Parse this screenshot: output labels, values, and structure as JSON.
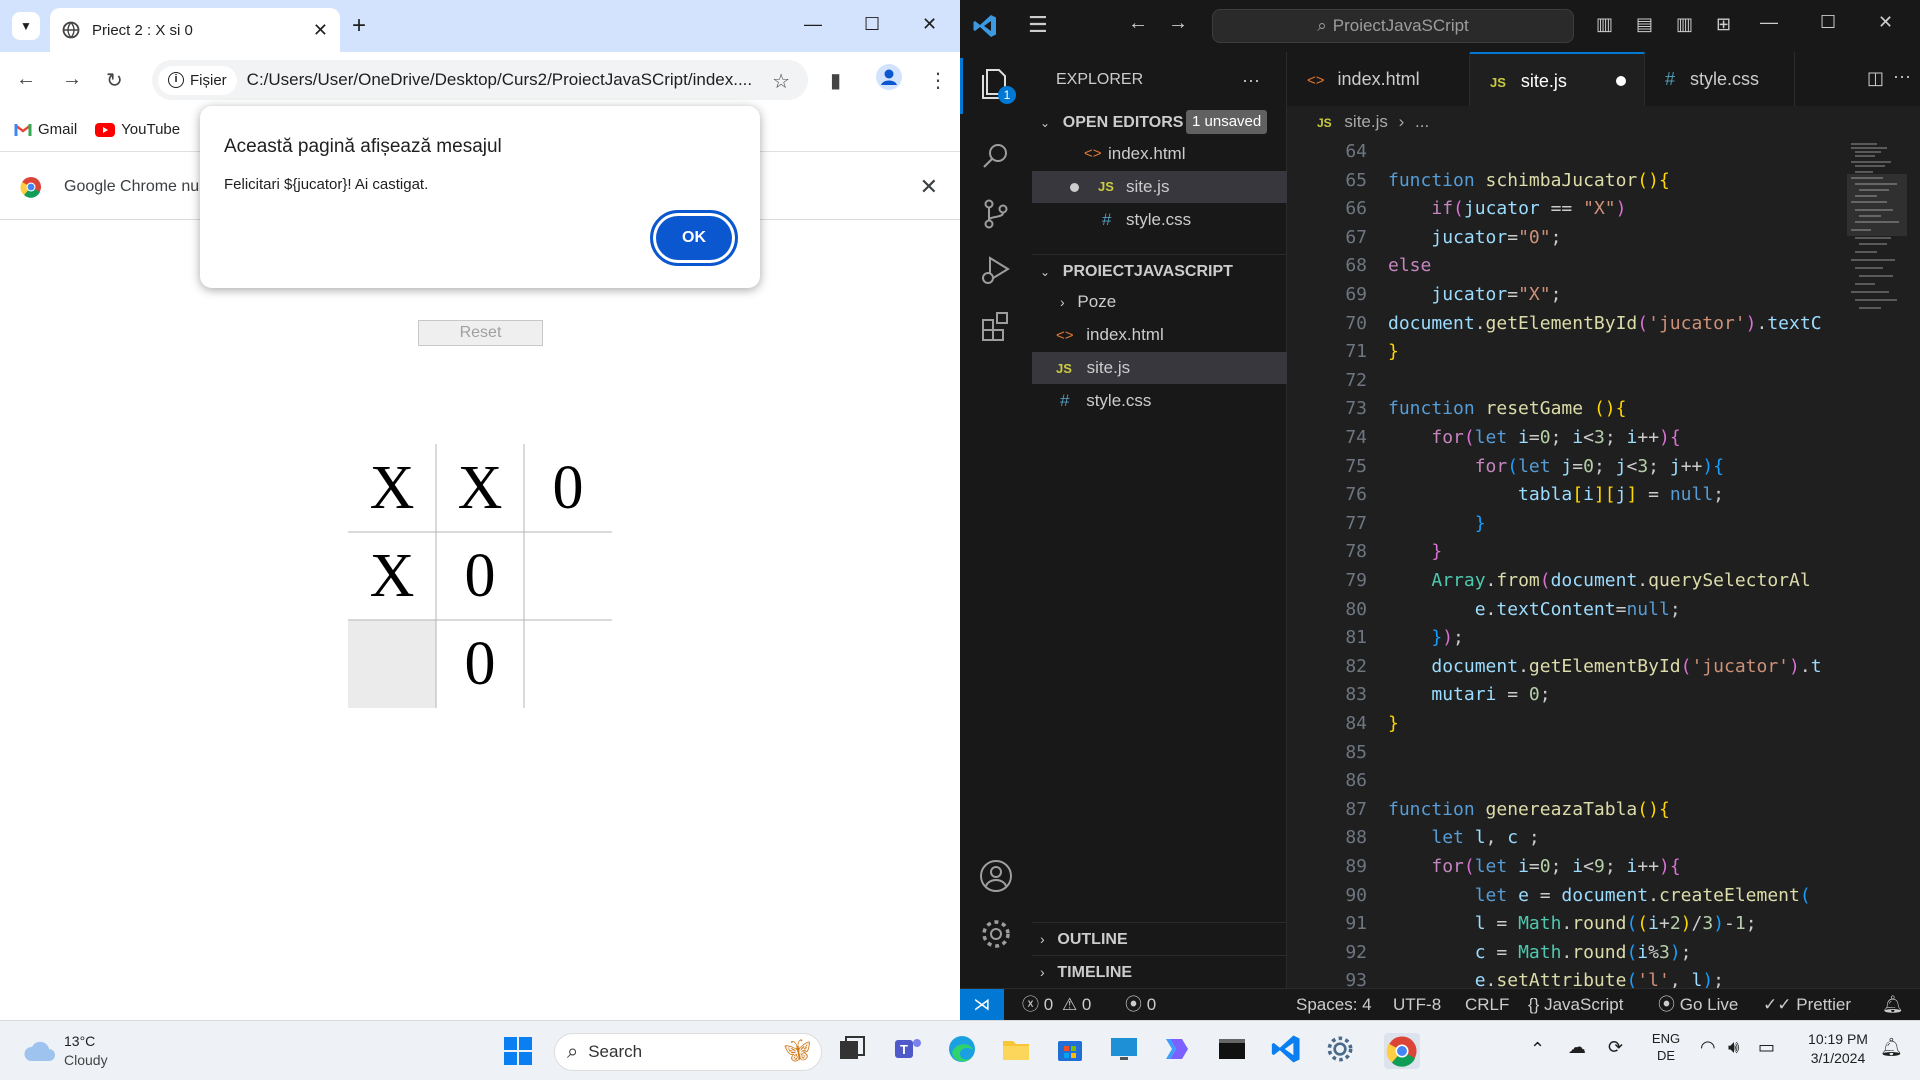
{
  "chrome": {
    "tab_title": "Priect 2 : X si 0",
    "address_chip": "Fișier",
    "url": "C:/Users/User/OneDrive/Desktop/Curs2/ProiectJavaSCript/index....",
    "bookmarks": [
      "Gmail",
      "YouTube"
    ],
    "infobar_text": "Google Chrome nu",
    "alert": {
      "title": "Această pagină afișează mesajul",
      "message": "Felicitari ${jucator}! Ai castigat.",
      "ok_label": "OK"
    },
    "reset_label": "Reset",
    "board": [
      [
        "X",
        "X",
        "0"
      ],
      [
        "X",
        "0",
        ""
      ],
      [
        "",
        "0",
        ""
      ]
    ]
  },
  "vscode": {
    "command_center": "ProiectJavaSCript",
    "explorer_title": "EXPLORER",
    "open_editors_label": "OPEN EDITORS",
    "unsaved_badge": "1 unsaved",
    "open_editors": [
      "index.html",
      "site.js",
      "style.css"
    ],
    "project_label": "PROIECTJAVASCRIPT",
    "project_items": [
      "Poze",
      "index.html",
      "site.js",
      "style.css"
    ],
    "outline_label": "OUTLINE",
    "timeline_label": "TIMELINE",
    "tabs": [
      "index.html",
      "site.js",
      "style.css"
    ],
    "breadcrumb": "site.js",
    "breadcrumb_more": "...",
    "activity_badge": "1",
    "code_lines": [
      {
        "n": "64",
        "html": ""
      },
      {
        "n": "65",
        "html": "<span class='b'>function</span> <span class='f'>schimbaJucator</span><span class='y'>()</span><span class='y'>{</span>"
      },
      {
        "n": "66",
        "html": "    <span class='k'>if</span><span class='p'>(</span><span class='v'>jucator</span> == <span class='s'>\"X\"</span><span class='p'>)</span>"
      },
      {
        "n": "67",
        "html": "    <span class='v'>jucator</span>=<span class='s'>\"0\"</span>;"
      },
      {
        "n": "68",
        "html": "<span class='k'>else</span>"
      },
      {
        "n": "69",
        "html": "    <span class='v'>jucator</span>=<span class='s'>\"X\"</span>;"
      },
      {
        "n": "70",
        "html": "<span class='v'>document</span>.<span class='f'>getElementById</span><span class='p'>(</span><span class='s'>'jucator'</span><span class='p'>)</span>.<span class='v'>textC</span>"
      },
      {
        "n": "71",
        "html": "<span class='y'>}</span>"
      },
      {
        "n": "72",
        "html": ""
      },
      {
        "n": "73",
        "html": "<span class='b'>function</span> <span class='f'>resetGame</span> <span class='y'>()</span><span class='y'>{</span>"
      },
      {
        "n": "74",
        "html": "    <span class='k'>for</span><span class='p'>(</span><span class='b'>let</span> <span class='v'>i</span>=<span class='n'>0</span>; <span class='v'>i</span>&lt;<span class='n'>3</span>; <span class='v'>i</span>++<span class='p'>)</span><span class='p'>{</span>"
      },
      {
        "n": "75",
        "html": "        <span class='k'>for</span><span class='bl'>(</span><span class='b'>let</span> <span class='v'>j</span>=<span class='n'>0</span>; <span class='v'>j</span>&lt;<span class='n'>3</span>; <span class='v'>j</span>++<span class='bl'>)</span><span class='bl'>{</span>"
      },
      {
        "n": "76",
        "html": "            <span class='v'>tabla</span><span class='y'>[</span><span class='v'>i</span><span class='y'>]</span><span class='y'>[</span><span class='v'>j</span><span class='y'>]</span> = <span class='b'>null</span>;"
      },
      {
        "n": "77",
        "html": "        <span class='bl'>}</span>"
      },
      {
        "n": "78",
        "html": "    <span class='p'>}</span>"
      },
      {
        "n": "79",
        "html": "    <span class='c'>Array</span>.<span class='f'>from</span><span class='p'>(</span><span class='v'>document</span>.<span class='f'>querySelectorAl</span>"
      },
      {
        "n": "80",
        "html": "        <span class='v'>e</span>.<span class='v'>textContent</span>=<span class='b'>null</span>;"
      },
      {
        "n": "81",
        "html": "    <span class='bl'>}</span><span class='p'>)</span>;"
      },
      {
        "n": "82",
        "html": "    <span class='v'>document</span>.<span class='f'>getElementById</span><span class='p'>(</span><span class='s'>'jucator'</span><span class='p'>)</span>.<span class='v'>t</span>"
      },
      {
        "n": "83",
        "html": "    <span class='v'>mutari</span> = <span class='n'>0</span>;"
      },
      {
        "n": "84",
        "html": "<span class='y'>}</span>"
      },
      {
        "n": "85",
        "html": ""
      },
      {
        "n": "86",
        "html": ""
      },
      {
        "n": "87",
        "html": "<span class='b'>function</span> <span class='f'>genereazaTabla</span><span class='y'>()</span><span class='y'>{</span>"
      },
      {
        "n": "88",
        "html": "    <span class='b'>let</span> <span class='v'>l</span>, <span class='v'>c</span> ;"
      },
      {
        "n": "89",
        "html": "    <span class='k'>for</span><span class='p'>(</span><span class='b'>let</span> <span class='v'>i</span>=<span class='n'>0</span>; <span class='v'>i</span>&lt;<span class='n'>9</span>; <span class='v'>i</span>++<span class='p'>)</span><span class='p'>{</span>"
      },
      {
        "n": "90",
        "html": "        <span class='b'>let</span> <span class='v'>e</span> = <span class='v'>document</span>.<span class='f'>createElement</span><span class='bl'>(</span>"
      },
      {
        "n": "91",
        "html": "        <span class='v'>l</span> = <span class='c'>Math</span>.<span class='f'>round</span><span class='bl'>(</span><span class='y'>(</span><span class='v'>i</span>+<span class='n'>2</span><span class='y'>)</span>/<span class='n'>3</span><span class='bl'>)</span>-<span class='n'>1</span>;"
      },
      {
        "n": "92",
        "html": "        <span class='v'>c</span> = <span class='c'>Math</span>.<span class='f'>round</span><span class='bl'>(</span><span class='v'>i</span>%<span class='n'>3</span><span class='bl'>)</span>;"
      },
      {
        "n": "93",
        "html": "        <span class='v'>e</span>.<span class='f'>setAttribute</span><span class='bl'>(</span><span class='s'>'l'</span>, <span class='v'>l</span><span class='bl'>)</span>;"
      }
    ],
    "status": {
      "errors": "0",
      "warnings": "0",
      "ports": "0",
      "spaces": "Spaces: 4",
      "encoding": "UTF-8",
      "eol": "CRLF",
      "language": "JavaScript",
      "golive": "Go Live",
      "prettier": "Prettier"
    }
  },
  "taskbar": {
    "weather_temp": "13°C",
    "weather_desc": "Cloudy",
    "search_label": "Search",
    "lang_top": "ENG",
    "lang_bottom": "DE",
    "time": "10:19 PM",
    "date": "3/1/2024"
  }
}
